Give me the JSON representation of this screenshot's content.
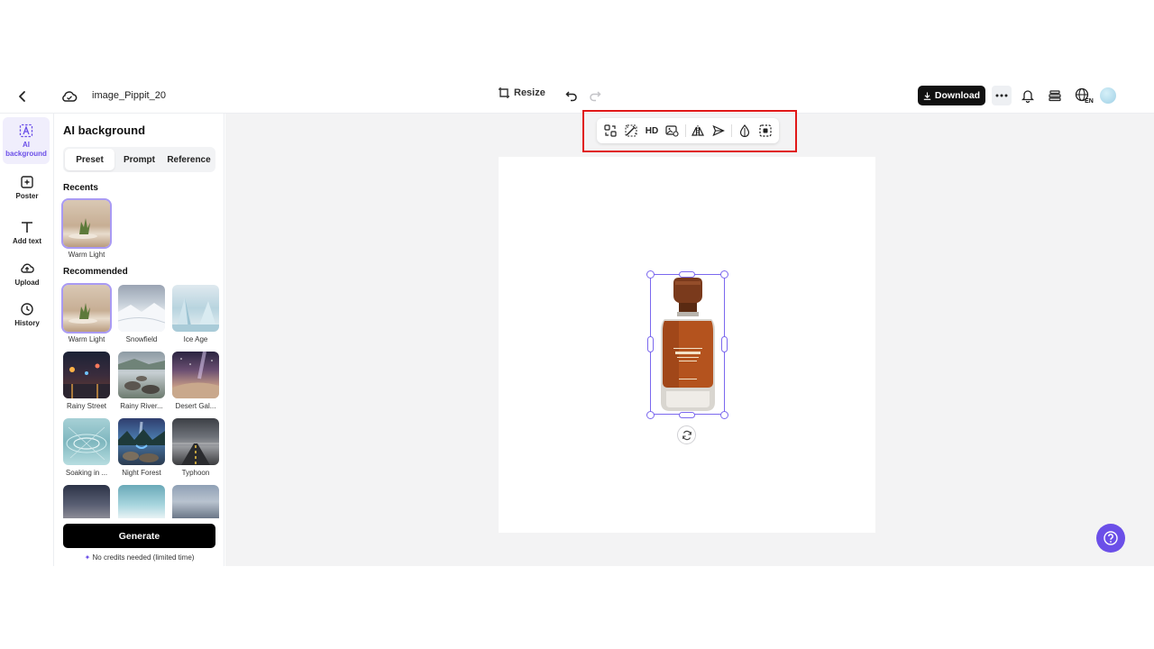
{
  "header": {
    "filename": "image_Pippit_20",
    "resize_label": "Resize",
    "download_label": "Download",
    "language_badge": "EN"
  },
  "rail": {
    "items": [
      {
        "label": "AI background",
        "icon": "ai-background-icon",
        "active": true
      },
      {
        "label": "Poster",
        "icon": "poster-icon"
      },
      {
        "label": "Add text",
        "icon": "text-icon"
      },
      {
        "label": "Upload",
        "icon": "upload-icon"
      },
      {
        "label": "History",
        "icon": "history-icon"
      }
    ],
    "ai_line1": "AI",
    "ai_line2": "background"
  },
  "panel": {
    "title": "AI background",
    "tabs": [
      "Preset",
      "Prompt",
      "Reference"
    ],
    "active_tab": "Preset",
    "recents_title": "Recents",
    "recents": [
      {
        "label": "Warm Light"
      }
    ],
    "recommended_title": "Recommended",
    "recommended": [
      {
        "label": "Warm Light"
      },
      {
        "label": "Snowfield"
      },
      {
        "label": "Ice Age"
      },
      {
        "label": "Rainy Street"
      },
      {
        "label": "Rainy River..."
      },
      {
        "label": "Desert Gal..."
      },
      {
        "label": "Soaking in ..."
      },
      {
        "label": "Night Forest"
      },
      {
        "label": "Typhoon"
      }
    ],
    "generate_label": "Generate",
    "credits_note": "No credits needed (limited time)"
  },
  "toolbar": {
    "hd_label": "HD",
    "tools": [
      "replace-icon",
      "magic-edit-icon",
      "hd-icon",
      "image-replace-icon",
      "flip-icon",
      "send-icon",
      "opacity-icon",
      "cutout-icon"
    ]
  },
  "colors": {
    "accent": "#6b4fe8",
    "highlight": "#e01818",
    "selection": "#7b68ee"
  }
}
